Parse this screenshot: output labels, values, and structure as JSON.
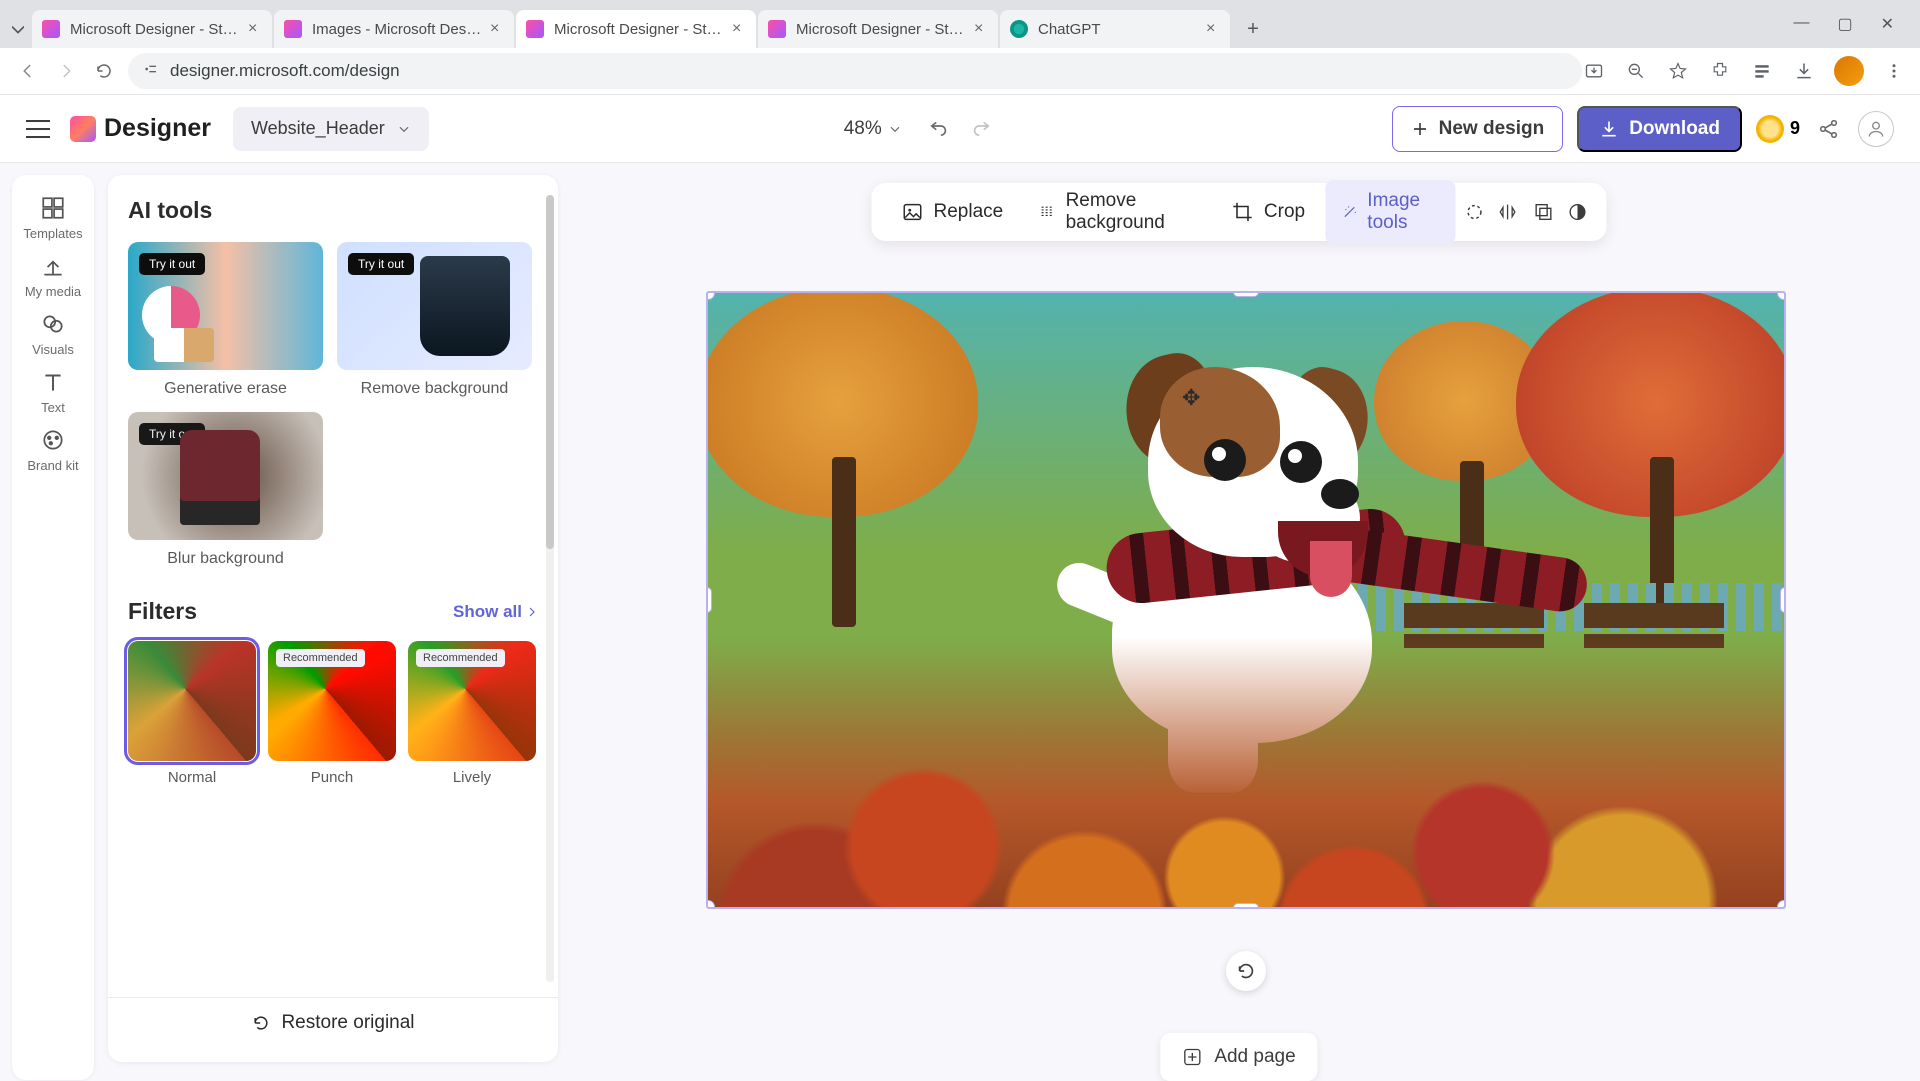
{
  "browser": {
    "tabs": [
      {
        "title": "Microsoft Designer - Stunning"
      },
      {
        "title": "Images - Microsoft Designer"
      },
      {
        "title": "Microsoft Designer - Stunning"
      },
      {
        "title": "Microsoft Designer - Stunning"
      },
      {
        "title": "ChatGPT"
      }
    ],
    "active_tab_index": 2,
    "url": "designer.microsoft.com/design"
  },
  "header": {
    "brand": "Designer",
    "document_name": "Website_Header",
    "zoom": "48%",
    "new_design_label": "New design",
    "download_label": "Download",
    "credits": "9"
  },
  "rail": {
    "items": [
      {
        "id": "templates",
        "label": "Templates"
      },
      {
        "id": "my-media",
        "label": "My media"
      },
      {
        "id": "visuals",
        "label": "Visuals"
      },
      {
        "id": "text",
        "label": "Text"
      },
      {
        "id": "brand-kit",
        "label": "Brand kit"
      }
    ]
  },
  "sidepanel": {
    "ai_tools_title": "AI tools",
    "try_badge": "Try it out",
    "tools": [
      {
        "id": "generative-erase",
        "label": "Generative erase"
      },
      {
        "id": "remove-background",
        "label": "Remove background"
      },
      {
        "id": "blur-background",
        "label": "Blur background"
      }
    ],
    "filters_title": "Filters",
    "show_all_label": "Show all",
    "recommended_badge": "Recommended",
    "filters": [
      {
        "id": "normal",
        "label": "Normal",
        "selected": true,
        "recommended": false
      },
      {
        "id": "punch",
        "label": "Punch",
        "selected": false,
        "recommended": true
      },
      {
        "id": "lively",
        "label": "Lively",
        "selected": false,
        "recommended": true
      }
    ],
    "restore_label": "Restore original"
  },
  "context_toolbar": {
    "replace": "Replace",
    "remove_bg": "Remove background",
    "crop": "Crop",
    "image_tools": "Image tools"
  },
  "canvas": {
    "add_page_label": "Add page"
  }
}
